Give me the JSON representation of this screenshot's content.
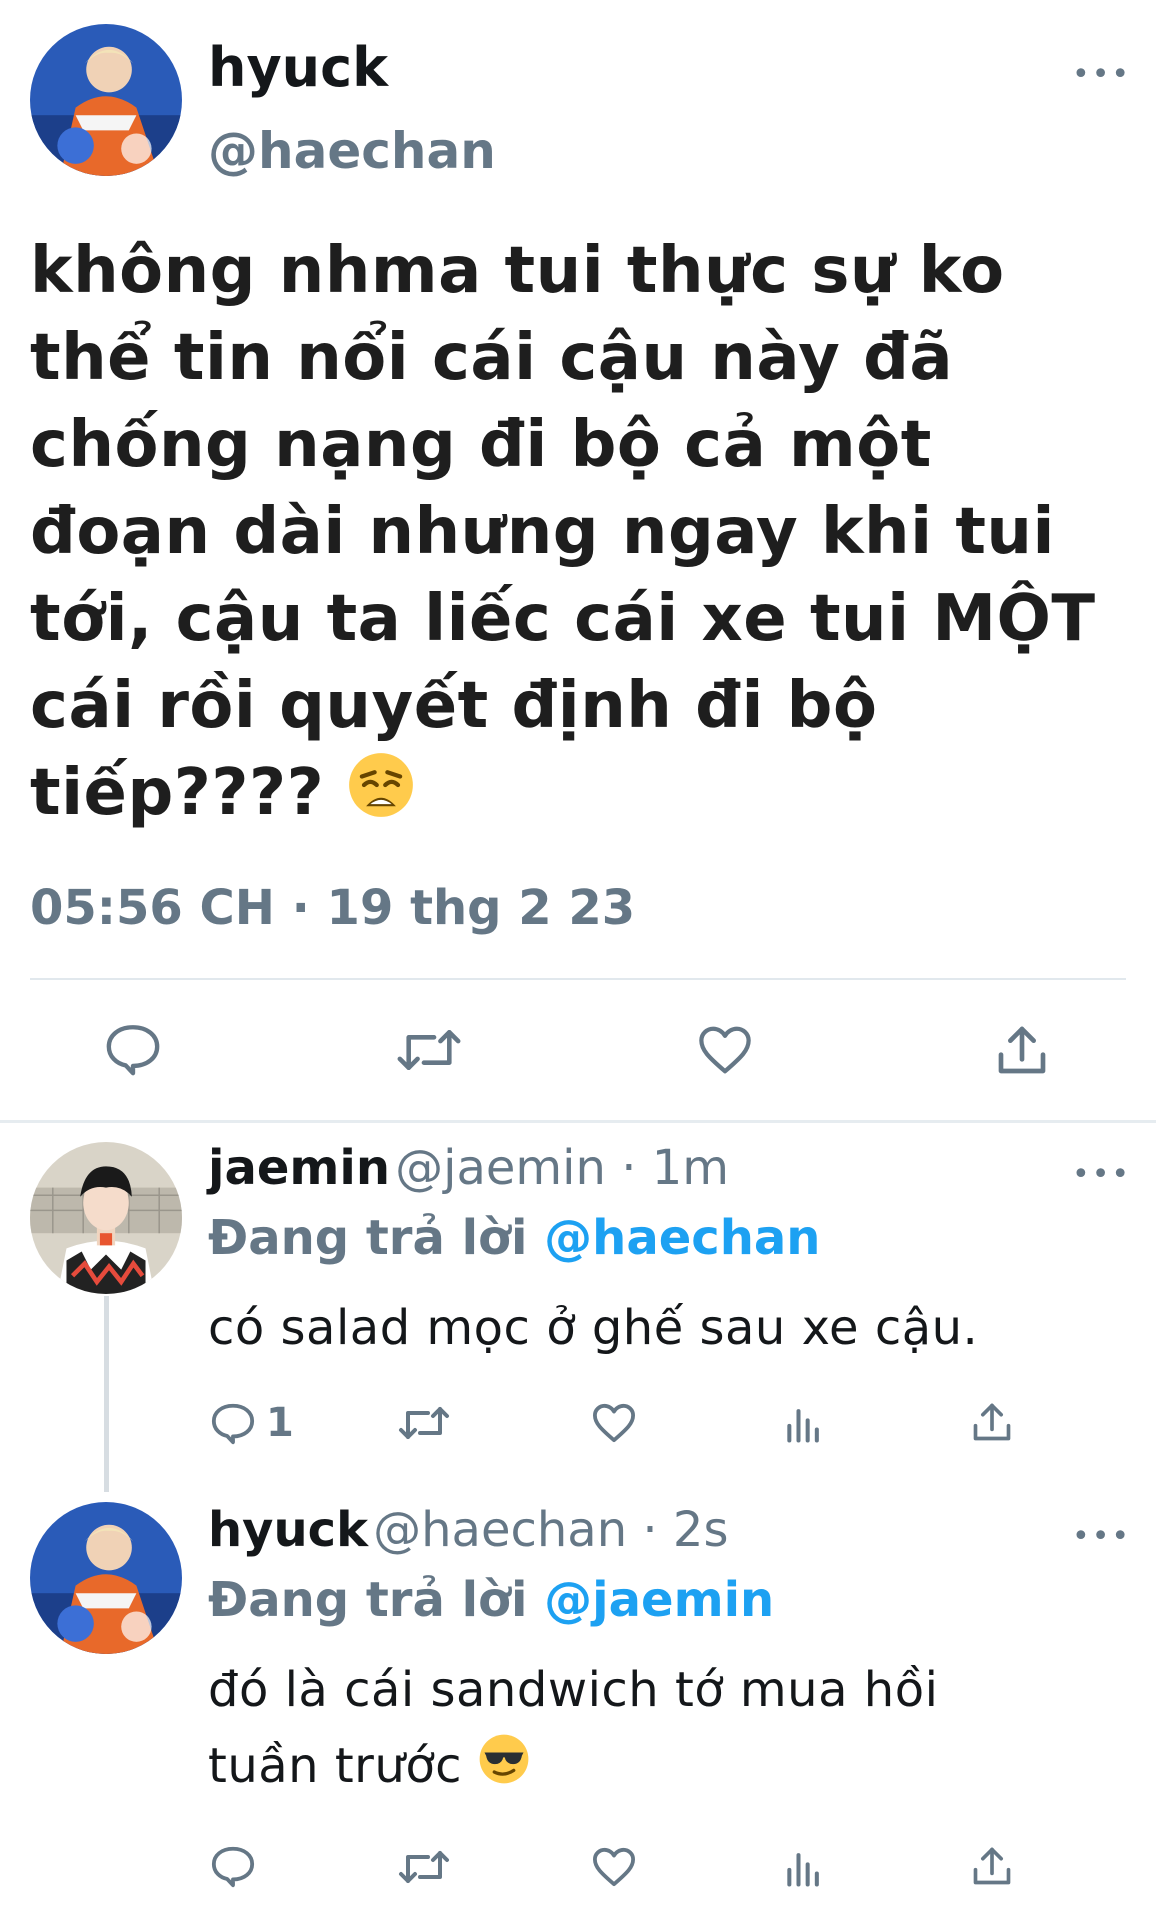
{
  "main_tweet": {
    "display_name": "hyuck",
    "handle": "@haechan",
    "text": "không nhma tui thực sự ko thể tin nổi cái cậu này đã chống nạng đi bộ cả một đoạn dài nhưng ngay khi tui tới, cậu ta liếc cái xe tui MỘT cái rồi quyết định đi bộ tiếp????",
    "emoji": "weary-face",
    "timestamp": "05:56 CH · 19 thg 2 23",
    "more_label": "•••",
    "actions": [
      "reply",
      "retweet",
      "like",
      "share"
    ]
  },
  "replies": [
    {
      "display_name": "jaemin",
      "meta": "@jaemin · 1m",
      "replying_label": "Đang trả lời",
      "replying_to": "@haechan",
      "text": "có salad mọc ở ghế sau xe cậu.",
      "reply_count": "1",
      "more_label": "•••"
    },
    {
      "display_name": "hyuck",
      "meta": "@haechan · 2s",
      "replying_label": "Đang trả lời",
      "replying_to": "@jaemin",
      "text_line1": "đó là cái sandwich tớ mua hồi",
      "text_line2": "tuần trước",
      "emoji": "smiling-face-with-sunglasses",
      "more_label": "•••"
    }
  ],
  "colors": {
    "text_primary": "#14171a",
    "text_secondary": "#657786",
    "accent": "#1da1f2",
    "divider": "#e1e8ed"
  }
}
